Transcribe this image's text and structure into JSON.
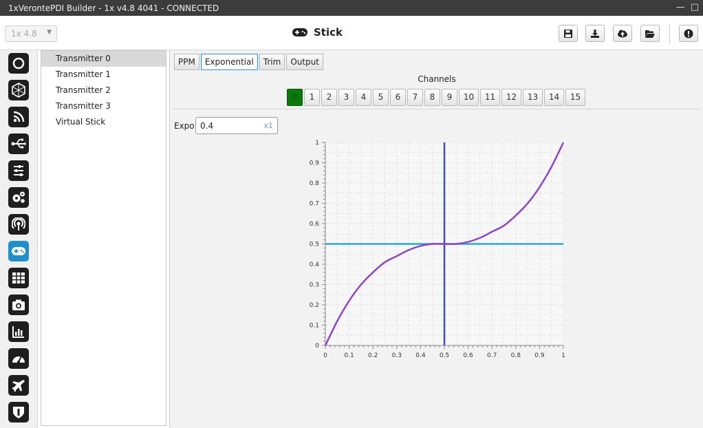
{
  "window": {
    "title": "1xVerontePDI Builder - 1x v4.8 4041 - CONNECTED",
    "controls": [
      "—",
      "□"
    ]
  },
  "toolbar": {
    "version_select": "1x 4.8",
    "heading": "Stick",
    "buttons": [
      "save",
      "download",
      "cloud-upload",
      "open-folder",
      "alert"
    ]
  },
  "rail": {
    "items": [
      "power",
      "hexagon-network",
      "rss",
      "usb",
      "sliders",
      "gears",
      "antenna",
      "gamepad",
      "grid",
      "camera",
      "bar-chart",
      "gauge",
      "airplane",
      "shield"
    ],
    "active_index": 7,
    "active_color": "#1f8ecd"
  },
  "transmitters": {
    "items": [
      "Transmitter 0",
      "Transmitter 1",
      "Transmitter 2",
      "Transmitter 3",
      "Virtual Stick"
    ],
    "selected_index": 0
  },
  "tabs": {
    "items": [
      "PPM",
      "Exponential",
      "Trim",
      "Output"
    ],
    "active_index": 1
  },
  "channels": {
    "label": "Channels",
    "items": [
      "0",
      "1",
      "2",
      "3",
      "4",
      "5",
      "6",
      "7",
      "8",
      "9",
      "10",
      "11",
      "12",
      "13",
      "14",
      "15"
    ],
    "active_index": 0,
    "active_color": "#0a7a0a"
  },
  "expo": {
    "label": "Expo",
    "value": "0.4",
    "unit": "x1"
  },
  "chart_data": {
    "type": "line",
    "title": "",
    "xlabel": "",
    "ylabel": "",
    "xlim": [
      0,
      1
    ],
    "ylim": [
      0,
      1
    ],
    "xticks": [
      "0",
      "0.1",
      "0.2",
      "0.3",
      "0.4",
      "0.5",
      "0.6",
      "0.7",
      "0.8",
      "0.9",
      "1"
    ],
    "yticks": [
      "0",
      "0.1",
      "0.2",
      "0.3",
      "0.4",
      "0.5",
      "0.6",
      "0.7",
      "0.8",
      "0.9",
      "1"
    ],
    "grid": true,
    "series": [
      {
        "color": "#8e44c8",
        "x": [
          0,
          0.05,
          0.1,
          0.15,
          0.2,
          0.25,
          0.3,
          0.35,
          0.4,
          0.45,
          0.5,
          0.55,
          0.6,
          0.65,
          0.7,
          0.75,
          0.8,
          0.85,
          0.9,
          0.95,
          1
        ],
        "y": [
          0,
          0.12,
          0.22,
          0.3,
          0.36,
          0.41,
          0.44,
          0.47,
          0.49,
          0.5,
          0.5,
          0.5,
          0.51,
          0.53,
          0.56,
          0.59,
          0.64,
          0.7,
          0.78,
          0.88,
          1
        ]
      }
    ],
    "crosshair": {
      "x": 0.5,
      "y": 0.5,
      "vertical_color": "#3a4fd0",
      "horizontal_color": "#2aa6d8"
    }
  }
}
